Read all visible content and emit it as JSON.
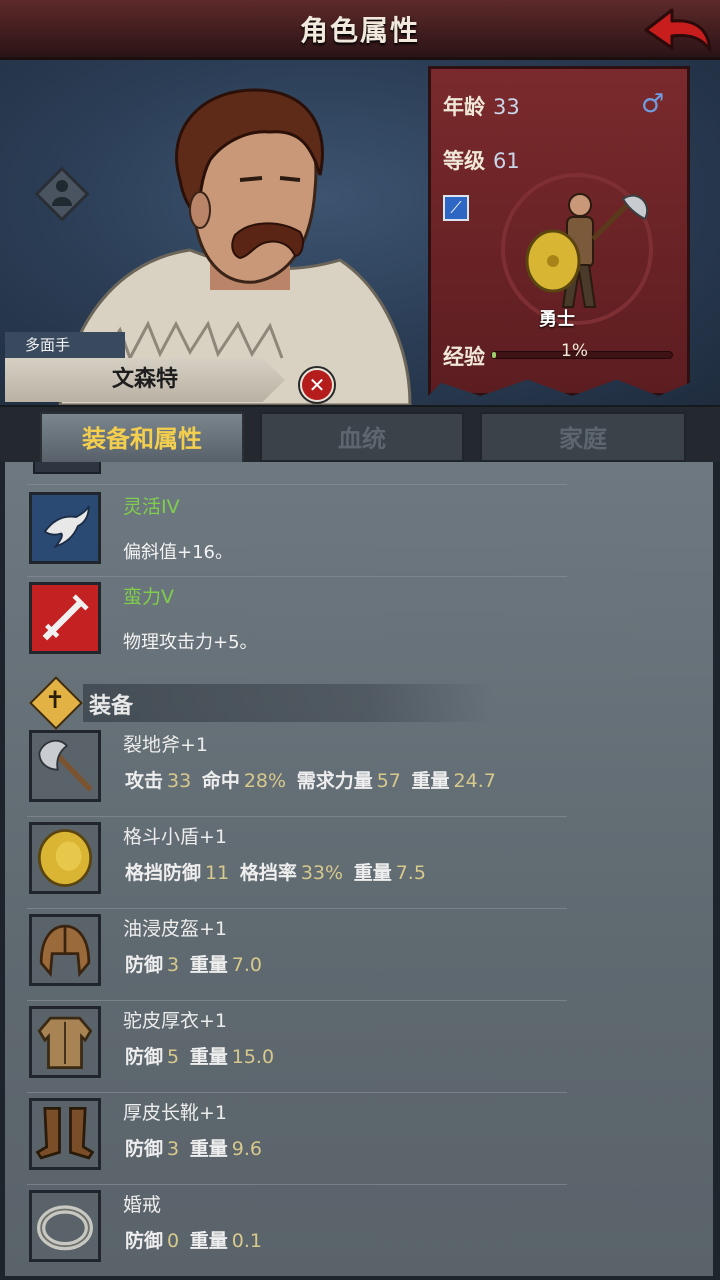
{
  "header": {
    "title": "角色属性"
  },
  "hero": {
    "trait": "多面手",
    "name": "文森特",
    "stats": {
      "age_label": "年龄",
      "age": "33",
      "level_label": "等级",
      "level": "61",
      "gender_symbol": "♂",
      "class_name": "勇士",
      "exp_label": "经验",
      "exp_percent": "1%",
      "exp_fraction": 0.01
    }
  },
  "tabs": [
    {
      "label": "装备和属性",
      "active": true
    },
    {
      "label": "血统",
      "active": false
    },
    {
      "label": "家庭",
      "active": false
    }
  ],
  "traits": [
    {
      "name": "灵活IV",
      "desc": "偏斜值+16。",
      "icon": "bird-icon"
    },
    {
      "name": "蛮力V",
      "desc": "物理攻击力+5。",
      "icon": "sword-icon"
    }
  ],
  "equipment_header": "装备",
  "equipment": [
    {
      "name": "裂地斧+1",
      "icon": "axe-icon",
      "stats": [
        [
          "攻击",
          "33"
        ],
        [
          "命中",
          "28%"
        ],
        [
          "需求力量",
          "57"
        ],
        [
          "重量",
          "24.7"
        ]
      ]
    },
    {
      "name": "格斗小盾+1",
      "icon": "shield-icon",
      "stats": [
        [
          "格挡防御",
          "11"
        ],
        [
          "格挡率",
          "33%"
        ],
        [
          "重量",
          "7.5"
        ]
      ]
    },
    {
      "name": "油浸皮盔+1",
      "icon": "helmet-icon",
      "stats": [
        [
          "防御",
          "3"
        ],
        [
          "重量",
          "7.0"
        ]
      ]
    },
    {
      "name": "驼皮厚衣+1",
      "icon": "armor-icon",
      "stats": [
        [
          "防御",
          "5"
        ],
        [
          "重量",
          "15.0"
        ]
      ]
    },
    {
      "name": "厚皮长靴+1",
      "icon": "boots-icon",
      "stats": [
        [
          "防御",
          "3"
        ],
        [
          "重量",
          "9.6"
        ]
      ]
    },
    {
      "name": "婚戒",
      "icon": "ring-icon",
      "stats": [
        [
          "防御",
          "0"
        ],
        [
          "重量",
          "0.1"
        ]
      ]
    }
  ],
  "colors": {
    "title_bar": "#4a2022",
    "banner": "#6a2326",
    "tab_active_text": "#f4cf4e",
    "trait_green": "#7fcf4c",
    "stat_number": "#d7c98c"
  }
}
